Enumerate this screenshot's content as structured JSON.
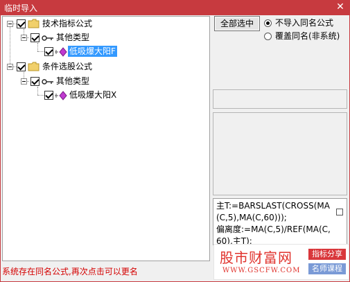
{
  "window": {
    "title": "临时导入",
    "close_glyph": "✕"
  },
  "tree": {
    "nodes": [
      {
        "label": "技术指标公式",
        "icon": "folder-icon",
        "checked": true
      },
      {
        "label": "其他类型",
        "icon": "key-icon",
        "checked": true
      },
      {
        "label": "低吸爆大阳F",
        "icon": "formula-diamond-icon",
        "checked": true,
        "selected": true
      },
      {
        "label": "条件选股公式",
        "icon": "folder-icon",
        "checked": true
      },
      {
        "label": "其他类型",
        "icon": "key-icon",
        "checked": true
      },
      {
        "label": "低吸爆大阳X",
        "icon": "formula-diamond-icon",
        "checked": true
      }
    ]
  },
  "controls": {
    "select_all_label": "全部选中",
    "radio_skip_label": "不导入同名公式",
    "radio_overwrite_label": "覆盖同名(非系统)"
  },
  "formula_preview": "主T:=BARSLAST(CROSS(MA(C,5),MA(C,60)));\n偏离度:=MA(C,5)/REF(MA(C,60),主T);",
  "status_text": "系统存在同名公式,再次点击可以更名",
  "logo": {
    "brand": "股市财富网",
    "url": "WWW.GSCFW.COM",
    "tag1": "指标分享",
    "tag2": "名师课程"
  },
  "colors": {
    "title_bar": "#c73a3f",
    "selection": "#3399ff",
    "status_text": "#d40000",
    "logo_red": "#e0322c"
  }
}
